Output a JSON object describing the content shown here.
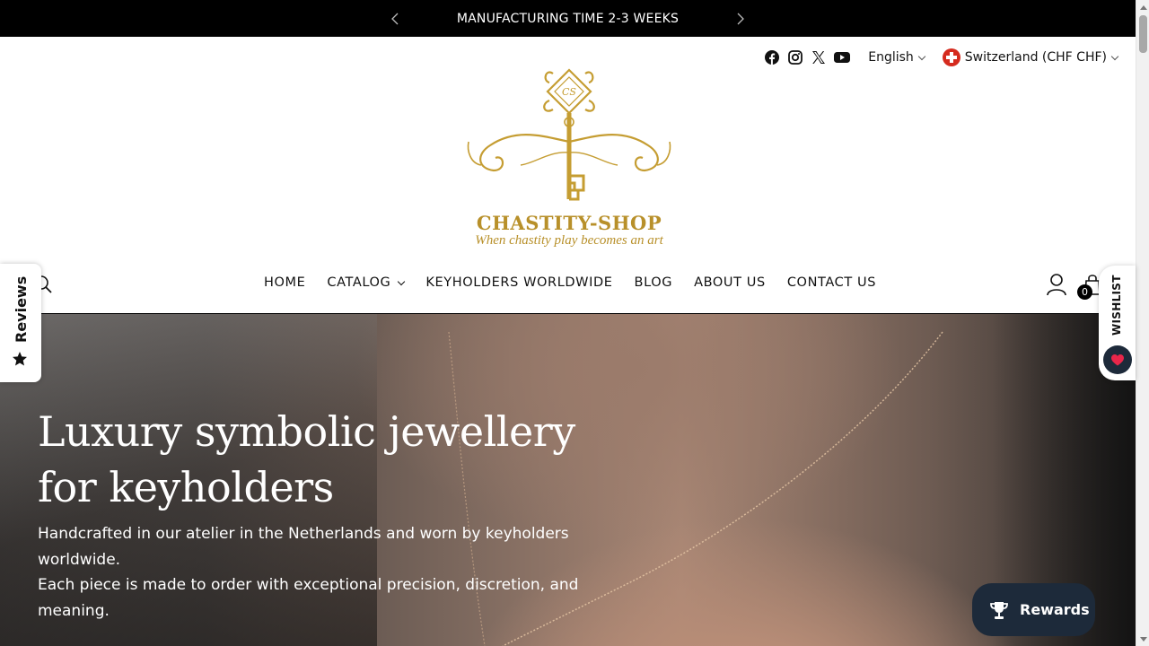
{
  "announcement": {
    "text": "MANUFACTURING TIME 2-3 WEEKS"
  },
  "utility": {
    "social": [
      "facebook-icon",
      "instagram-icon",
      "x-twitter-icon",
      "youtube-icon"
    ],
    "language": "English",
    "country": "Switzerland (CHF CHF)"
  },
  "logo": {
    "brand": "CHASTITY-SHOP",
    "tagline": "When chastity play becomes an art",
    "color": "#b8902a"
  },
  "nav": {
    "items": [
      {
        "label": "HOME"
      },
      {
        "label": "CATALOG",
        "dropdown": true
      },
      {
        "label": "KEYHOLDERS WORLDWIDE"
      },
      {
        "label": "BLOG"
      },
      {
        "label": "ABOUT US"
      },
      {
        "label": "CONTACT US"
      }
    ],
    "cart_count": "0"
  },
  "hero": {
    "title": "Luxury symbolic jewellery for keyholders",
    "paragraph1": "Handcrafted in our atelier in the Netherlands and worn by keyholders worldwide.",
    "paragraph2": "Each piece is made to order with exceptional precision, discretion, and meaning."
  },
  "widgets": {
    "reviews_label": "Reviews",
    "wishlist_label": "WISHLIST",
    "rewards_label": "Rewards",
    "accent": "#1d2a3a",
    "heart_color": "#e8264a"
  }
}
